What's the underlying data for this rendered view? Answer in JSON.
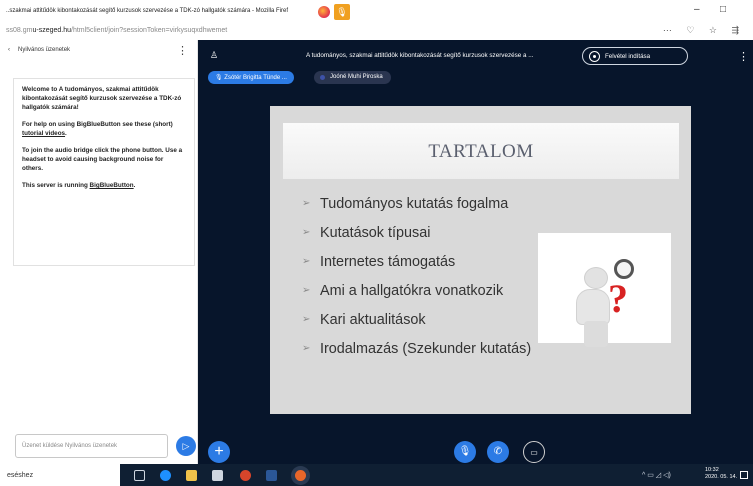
{
  "browser": {
    "title": "..szakmai attitűdök kibontakozását segítő kurzusok szervezése a TDK-zó hallgatók számára - Mozilla Firef",
    "url_prefix": "ss08.gm",
    "url_domain": "u-szeged.hu",
    "url_rest": "/html5client/join?sessionToken=virkysuqxdhwemet",
    "win_min": "–",
    "win_max": "□",
    "mic_badge": "🎙"
  },
  "chat": {
    "header_title": "Nyilvános üzenetek",
    "back": "‹",
    "menu": "⋮",
    "welcome_title": "Welcome to A tudományos, szakmai attitűdök kibontakozását segítő kurzusok szervezése a TDK-zó hallgatók számára!",
    "help_line": "For help on using BigBlueButton see these (short)",
    "help_link": "tutorial videos",
    "audio_line": "To join the audio bridge click the phone button. Use a headset to avoid causing background noise for others.",
    "server_line": "This server is running",
    "server_link": "BigBlueButton",
    "input_placeholder": "Üzenet küldése Nyilvános üzenetek",
    "send_icon": "▷"
  },
  "stage": {
    "user_icon": "♙",
    "meeting_title": "A tudományos, szakmai attitűdök kibontakozását segítő kurzusok szervezése a ...",
    "record_label": "Felvétel indítása",
    "menu": "⋮",
    "talkers": [
      "Zsótér Brigitta Tünde ...",
      "Joóné Muhi Piroska"
    ],
    "talker_icon": "🎙"
  },
  "slide": {
    "title": "TARTALOM",
    "bullets": [
      "Tudományos kutatás fogalma",
      "Kutatások típusai",
      "Internetes támogatás",
      "Ami a hallgatókra vonatkozik",
      "Kari aktualitások",
      "Irodalmazás (Szekunder kutatás)"
    ],
    "question_mark": "?"
  },
  "controls": {
    "plus": "+",
    "mic": "🎙",
    "phone": "✆",
    "camera": "▭"
  },
  "taskbar": {
    "search_text": "eséshez",
    "tray": "^ ▭ ◿ ◁)",
    "time": "10:32",
    "date": "2020. 05. 14."
  }
}
